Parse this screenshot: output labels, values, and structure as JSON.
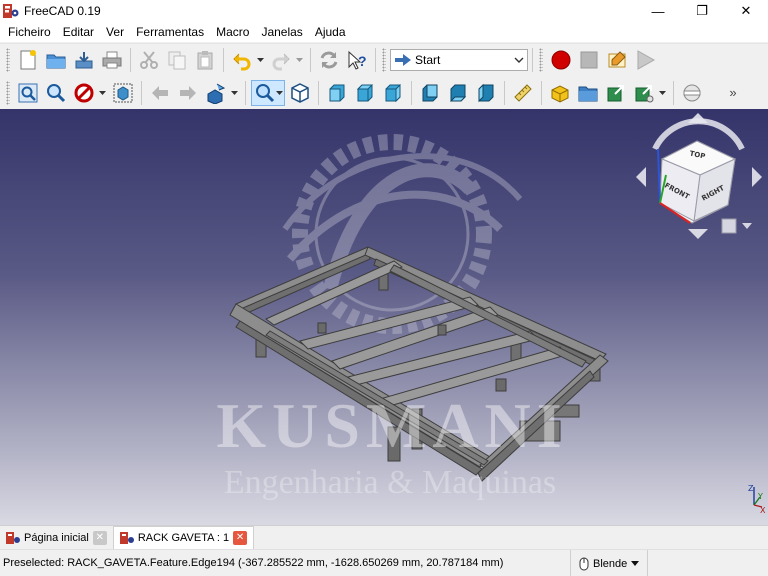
{
  "window": {
    "title": "FreeCAD 0.19",
    "logo_text": "F",
    "minimize": "—",
    "maximize": "❐",
    "close": "✕"
  },
  "menu": [
    "Ficheiro",
    "Editar",
    "Ver",
    "Ferramentas",
    "Macro",
    "Janelas",
    "Ajuda"
  ],
  "toolbar": {
    "workbench_selected": "Start",
    "more": "»"
  },
  "viewport": {
    "watermark_title": "KUSMANI",
    "watermark_subtitle": "Engenharia & Maquinas",
    "navcube_faces": [
      "FRONT",
      "RIGHT",
      "TOP"
    ],
    "axis_labels": [
      "Z",
      "Y",
      "X"
    ]
  },
  "tabs": [
    {
      "label": "Página inicial",
      "active": false
    },
    {
      "label": "RACK GAVETA : 1",
      "active": true
    }
  ],
  "status": {
    "message": "Preselected: RACK_GAVETA.Feature.Edge194 (-367.285522 mm, -1628.650269 mm, 20.787184 mm)",
    "navigation_style": "Blende"
  },
  "colors": {
    "accent_red": "#e5573f",
    "viewport_top": "#34346a",
    "viewport_bottom": "#d9d9e3",
    "model_gray": "#8a8a8a"
  }
}
